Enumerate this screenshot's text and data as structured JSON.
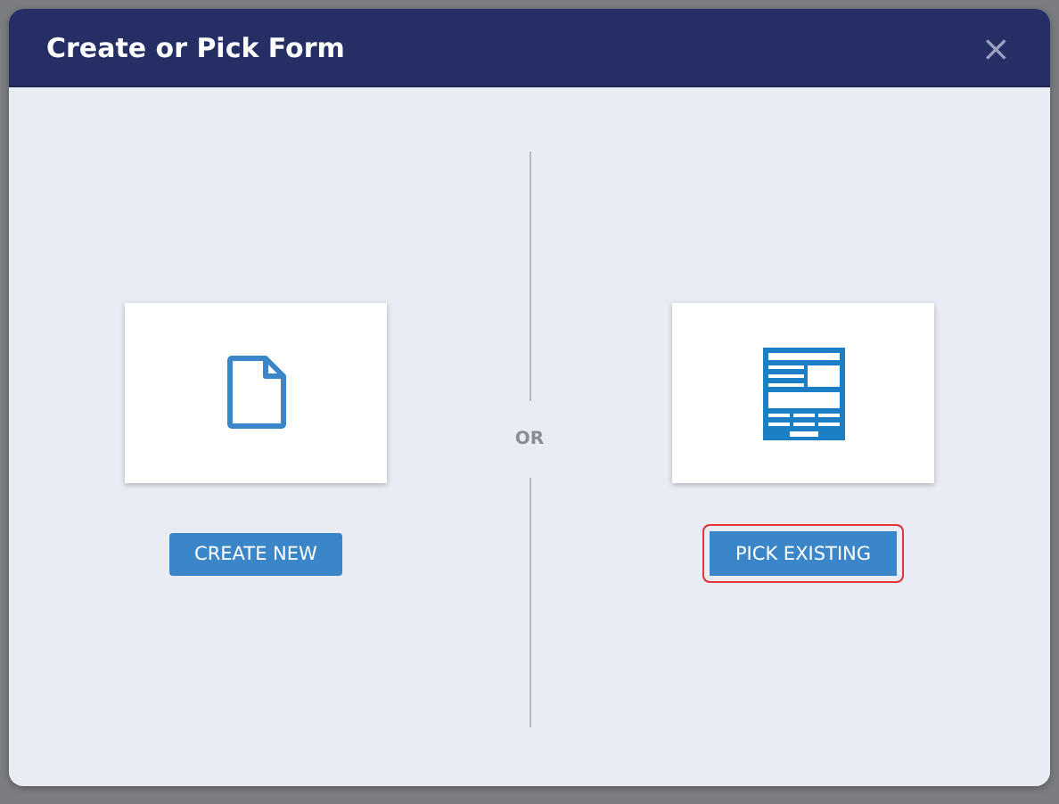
{
  "dialog": {
    "title": "Create or Pick Form",
    "close": "×"
  },
  "options": [
    {
      "kind": "blank",
      "button": "CREATE NEW",
      "highlighted": false
    },
    {
      "kind": "form",
      "button": "PICK EXISTING",
      "highlighted": true
    }
  ],
  "separator": "OR"
}
